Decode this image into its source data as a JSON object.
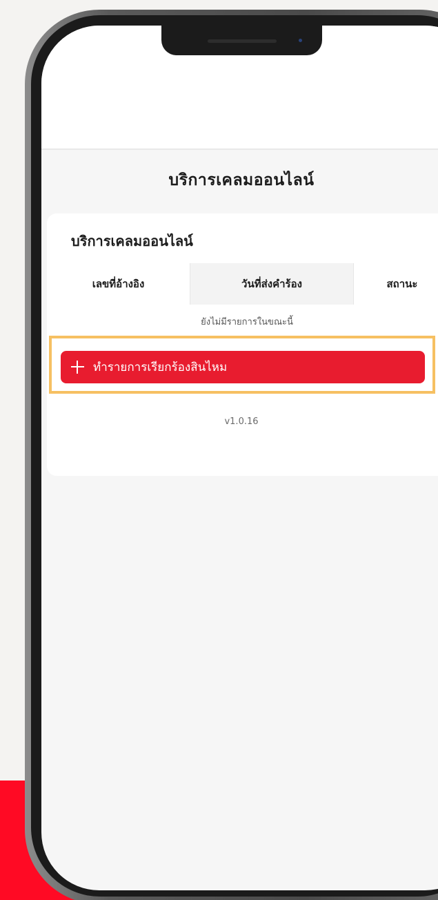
{
  "page": {
    "title": "บริการเคลมออนไลน์"
  },
  "card": {
    "title": "บริการเคลมออนไลน์",
    "columns": {
      "reference": "เลขที่อ้างอิง",
      "submitted_date": "วันที่ส่งคำร้อง",
      "status": "สถานะ"
    },
    "empty_message": "ยังไม่มีรายการในขณะนี้"
  },
  "actions": {
    "new_claim_label": "ทำรายการเรียกร้องสินไหม",
    "new_claim_icon": "plus-icon"
  },
  "footer": {
    "version": "v1.0.16"
  },
  "colors": {
    "primary": "#e81c2f",
    "highlight": "#f6c062",
    "accent": "#ff0a24"
  }
}
